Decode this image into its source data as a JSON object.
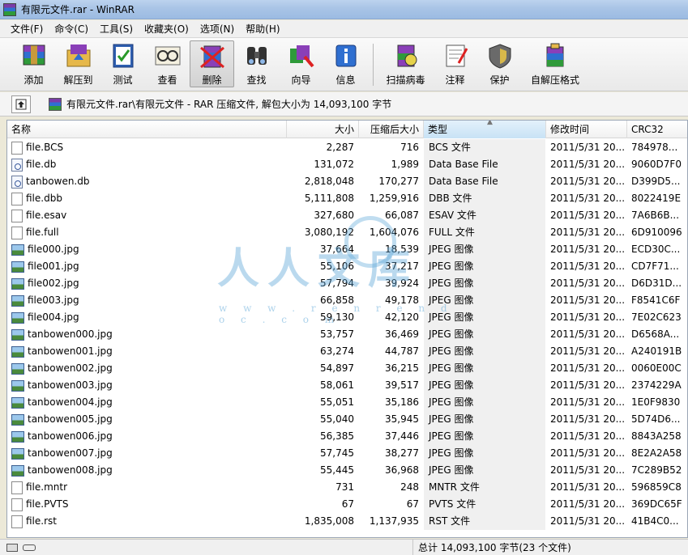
{
  "window": {
    "title": "有限元文件.rar - WinRAR"
  },
  "menu": [
    "文件(F)",
    "命令(C)",
    "工具(S)",
    "收藏夹(O)",
    "选项(N)",
    "帮助(H)"
  ],
  "toolbar": [
    {
      "label": "添加",
      "icon": "add-archive-icon"
    },
    {
      "label": "解压到",
      "icon": "extract-to-icon"
    },
    {
      "label": "测试",
      "icon": "test-icon"
    },
    {
      "label": "查看",
      "icon": "view-icon"
    },
    {
      "label": "删除",
      "icon": "delete-icon"
    },
    {
      "label": "查找",
      "icon": "find-icon"
    },
    {
      "label": "向导",
      "icon": "wizard-icon"
    },
    {
      "label": "信息",
      "icon": "info-icon"
    },
    {
      "label": "扫描病毒",
      "icon": "virus-scan-icon"
    },
    {
      "label": "注释",
      "icon": "comment-icon"
    },
    {
      "label": "保护",
      "icon": "protect-icon"
    },
    {
      "label": "自解压格式",
      "icon": "sfx-icon"
    }
  ],
  "address": {
    "path": "有限元文件.rar\\有限元文件 - RAR 压缩文件, 解包大小为 14,093,100 字节"
  },
  "columns": {
    "name": "名称",
    "size": "大小",
    "packed": "压缩后大小",
    "type": "类型",
    "modified": "修改时间",
    "crc": "CRC32"
  },
  "files": [
    {
      "name": "file.BCS",
      "size": "2,287",
      "packed": "716",
      "type": "BCS 文件",
      "modified": "2011/5/31 20...",
      "crc": "784978...",
      "icon": "plain"
    },
    {
      "name": "file.db",
      "size": "131,072",
      "packed": "1,989",
      "type": "Data Base File",
      "modified": "2011/5/31 20...",
      "crc": "9060D7F0",
      "icon": "db"
    },
    {
      "name": "tanbowen.db",
      "size": "2,818,048",
      "packed": "170,277",
      "type": "Data Base File",
      "modified": "2011/5/31 20...",
      "crc": "D399D5...",
      "icon": "db"
    },
    {
      "name": "file.dbb",
      "size": "5,111,808",
      "packed": "1,259,916",
      "type": "DBB 文件",
      "modified": "2011/5/31 20...",
      "crc": "8022419E",
      "icon": "plain"
    },
    {
      "name": "file.esav",
      "size": "327,680",
      "packed": "66,087",
      "type": "ESAV 文件",
      "modified": "2011/5/31 20...",
      "crc": "7A6B6B...",
      "icon": "plain"
    },
    {
      "name": "file.full",
      "size": "3,080,192",
      "packed": "1,604,076",
      "type": "FULL 文件",
      "modified": "2011/5/31 20...",
      "crc": "6D910096",
      "icon": "plain"
    },
    {
      "name": "file000.jpg",
      "size": "37,664",
      "packed": "18,539",
      "type": "JPEG 图像",
      "modified": "2011/5/31 20...",
      "crc": "ECD30C...",
      "icon": "img"
    },
    {
      "name": "file001.jpg",
      "size": "55,106",
      "packed": "37,217",
      "type": "JPEG 图像",
      "modified": "2011/5/31 20...",
      "crc": "CD7F71...",
      "icon": "img"
    },
    {
      "name": "file002.jpg",
      "size": "57,794",
      "packed": "39,924",
      "type": "JPEG 图像",
      "modified": "2011/5/31 20...",
      "crc": "D6D31D...",
      "icon": "img"
    },
    {
      "name": "file003.jpg",
      "size": "66,858",
      "packed": "49,178",
      "type": "JPEG 图像",
      "modified": "2011/5/31 20...",
      "crc": "F8541C6F",
      "icon": "img"
    },
    {
      "name": "file004.jpg",
      "size": "59,130",
      "packed": "42,120",
      "type": "JPEG 图像",
      "modified": "2011/5/31 20...",
      "crc": "7E02C623",
      "icon": "img"
    },
    {
      "name": "tanbowen000.jpg",
      "size": "53,757",
      "packed": "36,469",
      "type": "JPEG 图像",
      "modified": "2011/5/31 20...",
      "crc": "D6568A...",
      "icon": "img"
    },
    {
      "name": "tanbowen001.jpg",
      "size": "63,274",
      "packed": "44,787",
      "type": "JPEG 图像",
      "modified": "2011/5/31 20...",
      "crc": "A240191B",
      "icon": "img"
    },
    {
      "name": "tanbowen002.jpg",
      "size": "54,897",
      "packed": "36,215",
      "type": "JPEG 图像",
      "modified": "2011/5/31 20...",
      "crc": "0060E00C",
      "icon": "img"
    },
    {
      "name": "tanbowen003.jpg",
      "size": "58,061",
      "packed": "39,517",
      "type": "JPEG 图像",
      "modified": "2011/5/31 20...",
      "crc": "2374229A",
      "icon": "img"
    },
    {
      "name": "tanbowen004.jpg",
      "size": "55,051",
      "packed": "35,186",
      "type": "JPEG 图像",
      "modified": "2011/5/31 20...",
      "crc": "1E0F9830",
      "icon": "img"
    },
    {
      "name": "tanbowen005.jpg",
      "size": "55,040",
      "packed": "35,945",
      "type": "JPEG 图像",
      "modified": "2011/5/31 20...",
      "crc": "5D74D6...",
      "icon": "img"
    },
    {
      "name": "tanbowen006.jpg",
      "size": "56,385",
      "packed": "37,446",
      "type": "JPEG 图像",
      "modified": "2011/5/31 20...",
      "crc": "8843A258",
      "icon": "img"
    },
    {
      "name": "tanbowen007.jpg",
      "size": "57,745",
      "packed": "38,277",
      "type": "JPEG 图像",
      "modified": "2011/5/31 20...",
      "crc": "8E2A2A58",
      "icon": "img"
    },
    {
      "name": "tanbowen008.jpg",
      "size": "55,445",
      "packed": "36,968",
      "type": "JPEG 图像",
      "modified": "2011/5/31 20...",
      "crc": "7C289B52",
      "icon": "img"
    },
    {
      "name": "file.mntr",
      "size": "731",
      "packed": "248",
      "type": "MNTR 文件",
      "modified": "2011/5/31 20...",
      "crc": "596859C8",
      "icon": "plain"
    },
    {
      "name": "file.PVTS",
      "size": "67",
      "packed": "67",
      "type": "PVTS 文件",
      "modified": "2011/5/31 20...",
      "crc": "369DC65F",
      "icon": "plain"
    },
    {
      "name": "file.rst",
      "size": "1,835,008",
      "packed": "1,137,935",
      "type": "RST 文件",
      "modified": "2011/5/31 20...",
      "crc": "41B4C0...",
      "icon": "plain"
    }
  ],
  "watermark": {
    "text": "人人文库",
    "url": "w w w . r e n r e n d o c . c o m"
  },
  "status": {
    "total": "总计 14,093,100 字节(23 个文件)"
  }
}
